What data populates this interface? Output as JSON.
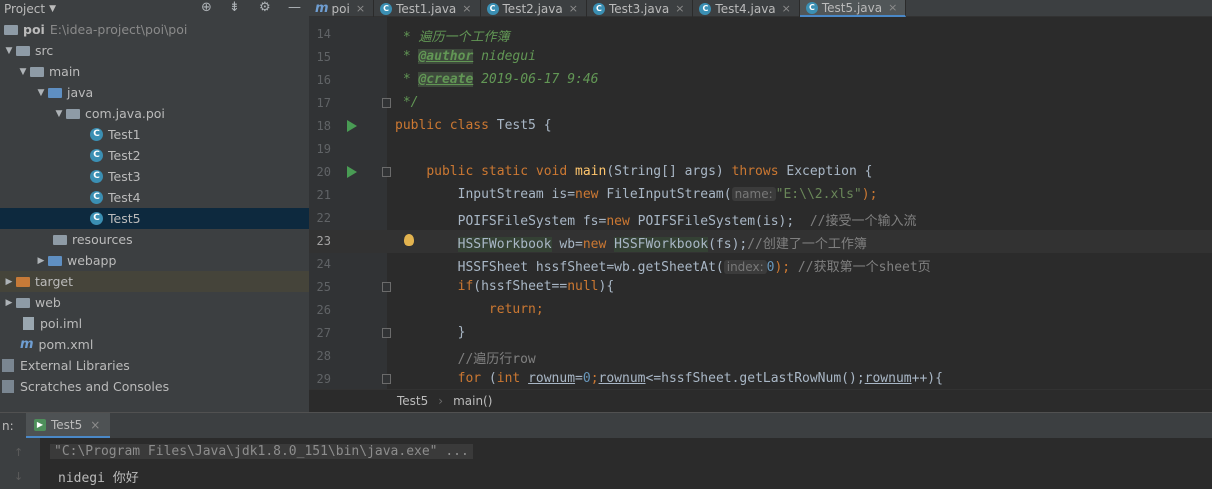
{
  "project": {
    "title": "Project",
    "tree": [
      {
        "label": "poi",
        "path": "E:\\idea-project\\poi\\poi"
      },
      {
        "label": "src"
      },
      {
        "label": "main"
      },
      {
        "label": "java"
      },
      {
        "label": "com.java.poi"
      },
      {
        "label": "Test1"
      },
      {
        "label": "Test2"
      },
      {
        "label": "Test3"
      },
      {
        "label": "Test4"
      },
      {
        "label": "Test5"
      },
      {
        "label": "resources"
      },
      {
        "label": "webapp"
      },
      {
        "label": "target"
      },
      {
        "label": "web"
      },
      {
        "label": "poi.iml"
      },
      {
        "label": "pom.xml"
      },
      {
        "label": "External Libraries"
      },
      {
        "label": "Scratches and Consoles"
      }
    ]
  },
  "tabs": [
    {
      "label": "poi"
    },
    {
      "label": "Test1.java"
    },
    {
      "label": "Test2.java"
    },
    {
      "label": "Test3.java"
    },
    {
      "label": "Test4.java"
    },
    {
      "label": "Test5.java"
    }
  ],
  "editor": {
    "line_numbers": [
      "14",
      "15",
      "16",
      "17",
      "18",
      "19",
      "20",
      "21",
      "22",
      "23",
      "24",
      "25",
      "26",
      "27",
      "28",
      "29"
    ],
    "c14": " * 遍历一个工作簿",
    "c15_tag": "@author",
    "c15_rest": " nidegui",
    "c16_tag": "@create",
    "c16_rest": " 2019-06-17 9:46",
    "c17": " */",
    "c18_kw": "public class",
    "c18_rest": " Test5 {",
    "c20_kw1": "public static void",
    "c20_fn": "main",
    "c20_mid": "(String[] args) ",
    "c20_kw2": "throws",
    "c20_rest": " Exception {",
    "c21_a": "InputStream is=",
    "c21_kw": "new",
    "c21_b": " FileInputStream(",
    "c21_hint": "name:",
    "c21_str": "\"E:\\\\2.xls\"",
    "c21_end": ");",
    "c22_a": "POIFSFileSystem fs=",
    "c22_kw": "new",
    "c22_b": " POIFSFileSystem(is);  ",
    "c22_cm": "//接受一个输入流",
    "c23_a": "HSSFWorkbook",
    "c23_b": " wb=",
    "c23_kw": "new",
    "c23_c": " ",
    "c23_d": "HSSFWorkbook",
    "c23_e": "(fs);",
    "c23_cm": "//创建了一个工作簿",
    "c24_a": "HSSFSheet hssfSheet=wb.getSheetAt(",
    "c24_hint": "index:",
    "c24_num": "0",
    "c24_end": "); ",
    "c24_cm": "//获取第一个sheet页",
    "c25_kw": "if",
    "c25_a": "(hssfSheet==",
    "c25_kw2": "null",
    "c25_b": "){",
    "c26_kw": "return",
    "c26_b": ";",
    "c27": "}",
    "c28_cm": "//遍历行row",
    "c29_kw": "for",
    "c29_a": " (",
    "c29_kw2": "int",
    "c29_b": " ",
    "c29_v1": "rownum",
    "c29_c": "=",
    "c29_num": "0",
    "c29_d": ";",
    "c29_v2": "rownum",
    "c29_e": "<=hssfSheet.getLastRowNum();",
    "c29_v3": "rownum",
    "c29_f": "++){"
  },
  "breadcrumb": {
    "a": "Test5",
    "b": "main()"
  },
  "run": {
    "label": "n:",
    "tab": "Test5",
    "cmd": "\"C:\\Program Files\\Java\\jdk1.8.0_151\\bin\\java.exe\" ...",
    "output": "nidegi 你好"
  },
  "colors": {
    "accent": "#4a88c7",
    "selection": "#0d293e",
    "keyword": "#cc7832",
    "comment": "#629755"
  }
}
